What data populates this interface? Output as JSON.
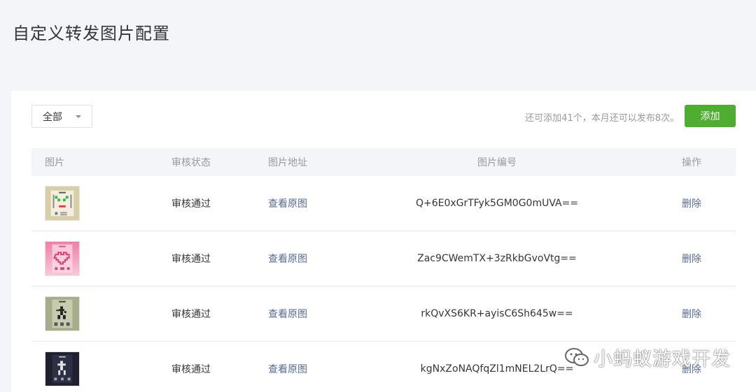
{
  "page": {
    "title": "自定义转发图片配置"
  },
  "toolbar": {
    "filter_value": "全部",
    "quota_text": "还可添加41个，本月还可以发布8次。",
    "add_label": "添加"
  },
  "table": {
    "headers": {
      "image": "图片",
      "status": "审核状态",
      "url": "图片地址",
      "id": "图片编号",
      "action": "操作"
    },
    "rows": [
      {
        "thumb": "face-thumbnail",
        "status": "审核通过",
        "link": "查看原图",
        "id": "Q+6E0xGrTFyk5GM0G0mUVA==",
        "action": "删除"
      },
      {
        "thumb": "heart-thumbnail",
        "status": "审核通过",
        "link": "查看原图",
        "id": "Zac9CWemTX+3zRkbGvoVtg==",
        "action": "删除"
      },
      {
        "thumb": "runner-thumbnail",
        "status": "审核通过",
        "link": "查看原图",
        "id": "rkQvXS6KR+ayisC6Sh645w==",
        "action": "删除"
      },
      {
        "thumb": "dancer-thumbnail",
        "status": "审核通过",
        "link": "查看原图",
        "id": "kgNxZoNAQfqZl1mNEL2LrQ==",
        "action": "删除"
      }
    ]
  },
  "watermark": {
    "text": "小蚂蚁游戏开发",
    "icon": "wechat-icon"
  },
  "colors": {
    "accent": "#4fae32",
    "link": "#576b95",
    "muted": "#9a9a9a"
  }
}
